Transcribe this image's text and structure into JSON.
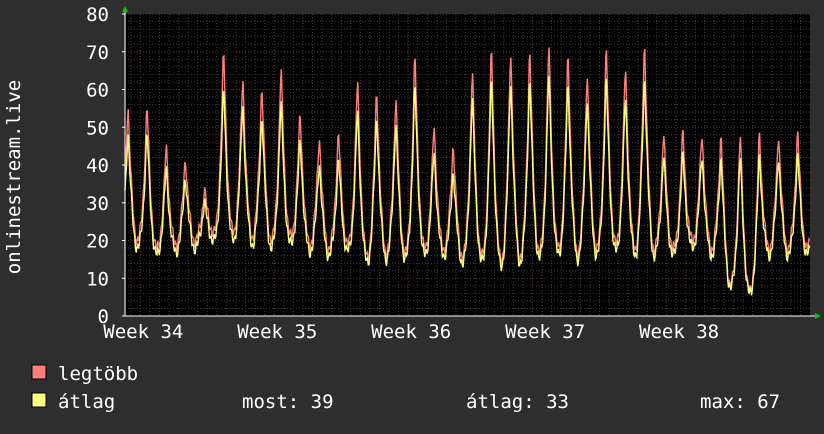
{
  "chart_data": {
    "type": "line",
    "ylabel": "onlinestream.live",
    "ylim": [
      0,
      80
    ],
    "yticks": [
      0,
      10,
      20,
      30,
      40,
      50,
      60,
      70,
      80
    ],
    "x_tick_labels": [
      "Week 34",
      "Week 35",
      "Week 36",
      "Week 37",
      "Week 38"
    ],
    "grid": true,
    "x_unit": "days since start of Week 34 (axis runs approx. -0.3 to 35.5)",
    "x_range": [
      -0.3,
      35.5
    ],
    "series": [
      {
        "name": "legtöbb",
        "color": "#ff7f7f",
        "daily_peaks": [
          57,
          46,
          43,
          34,
          72,
          65,
          63,
          67,
          55,
          49,
          50,
          64,
          62,
          60,
          71,
          52,
          47,
          67,
          73,
          73,
          73,
          74,
          72,
          67,
          73,
          68,
          75,
          50
        ]
      },
      {
        "name": "átlag",
        "color": "#ffff7f",
        "daily_peaks": [
          50,
          40,
          38,
          31,
          62,
          58,
          55,
          58,
          48,
          42,
          43,
          56,
          55,
          53,
          63,
          45,
          40,
          60,
          65,
          65,
          65,
          66,
          64,
          60,
          65,
          60,
          66,
          44
        ]
      }
    ],
    "daily_troughs": [
      19,
      17,
      18,
      19,
      21,
      21,
      20,
      19,
      20,
      18,
      17,
      18,
      15,
      16,
      16,
      17,
      17,
      15,
      15,
      14,
      15,
      16,
      17,
      16,
      17,
      18,
      17,
      17,
      17,
      19,
      17,
      8,
      6
    ],
    "trough_tail": 17,
    "legend": [
      {
        "label": "legtöbb",
        "color": "#ff7f7f"
      },
      {
        "label": "átlag",
        "color": "#ffff7f"
      }
    ],
    "stats": {
      "now_label": "most: 39",
      "avg_label": "átlag: 33",
      "max_label": "max: 67"
    }
  }
}
